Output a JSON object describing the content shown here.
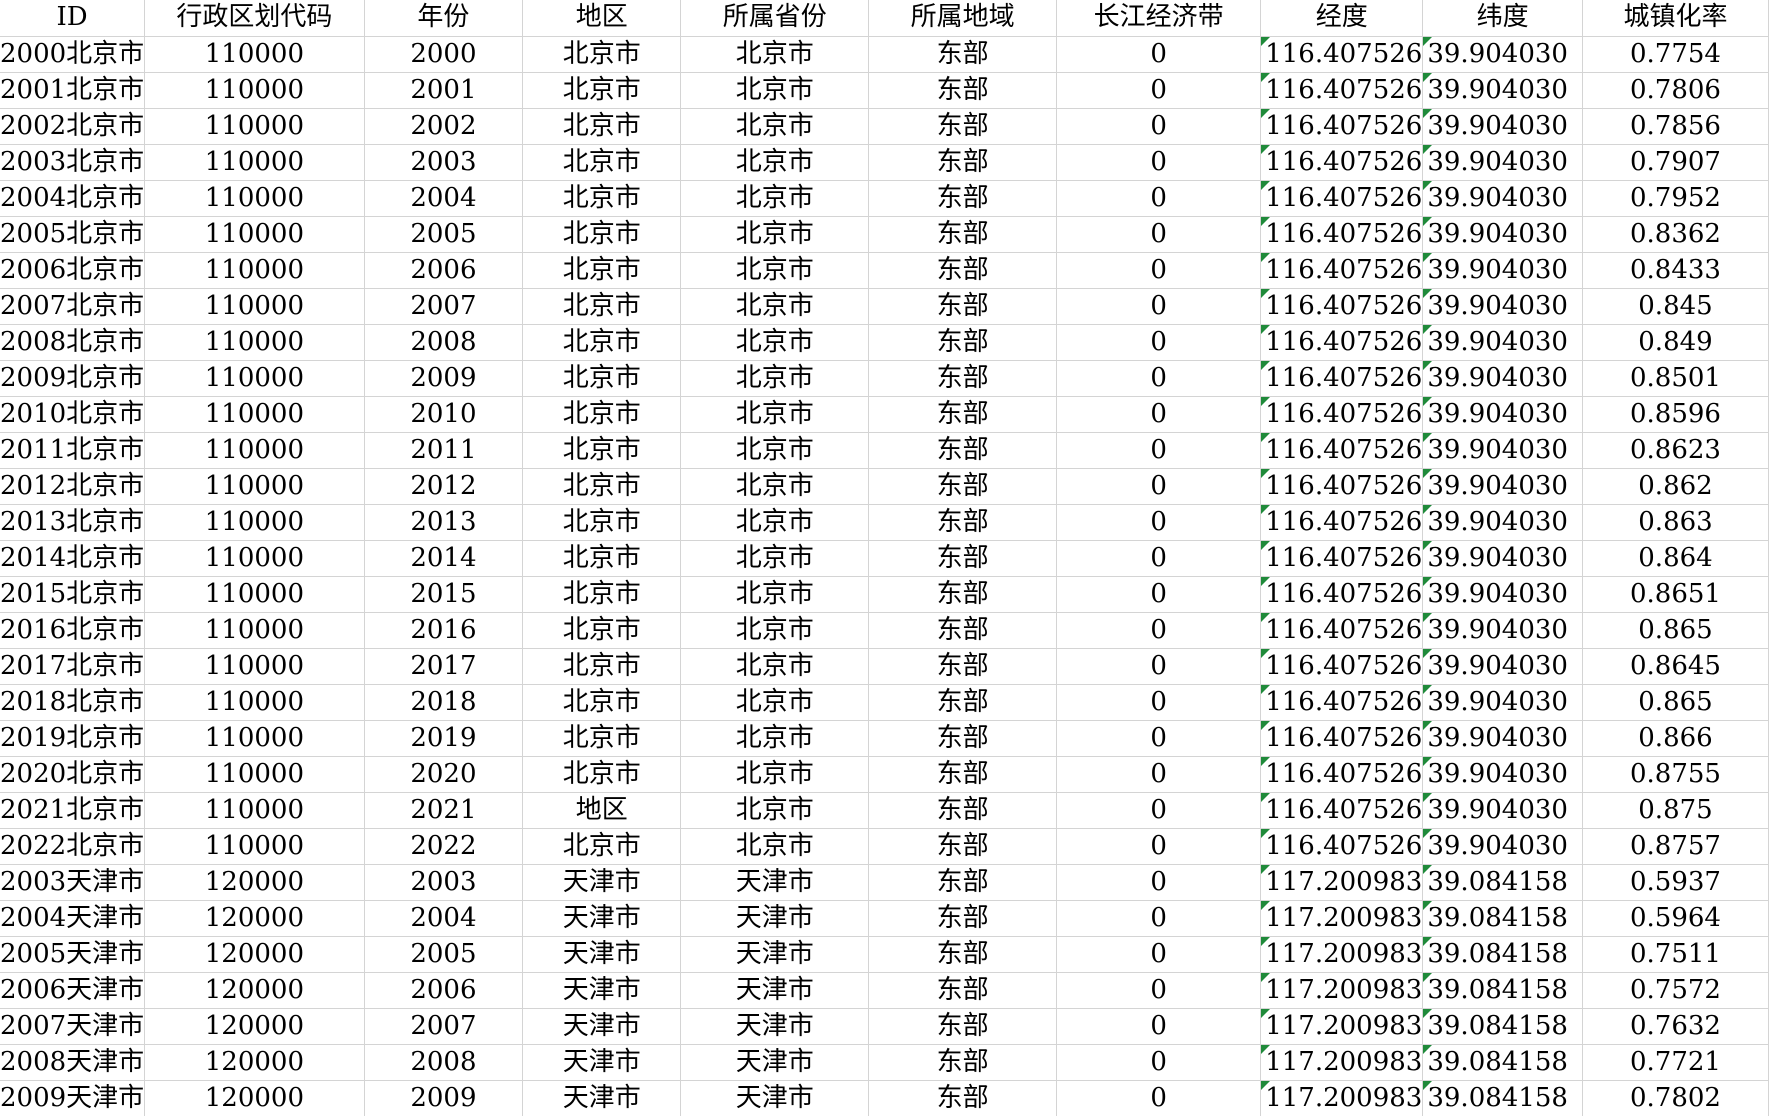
{
  "headers": [
    "ID",
    "行政区划代码",
    "年份",
    "地区",
    "所属省份",
    "所属地域",
    "长江经济带",
    "经度",
    "纬度",
    "城镇化率"
  ],
  "rows": [
    [
      "2000北京市",
      "110000",
      "2000",
      "北京市",
      "北京市",
      "东部",
      "0",
      "116.407526",
      "39.904030",
      "0.7754"
    ],
    [
      "2001北京市",
      "110000",
      "2001",
      "北京市",
      "北京市",
      "东部",
      "0",
      "116.407526",
      "39.904030",
      "0.7806"
    ],
    [
      "2002北京市",
      "110000",
      "2002",
      "北京市",
      "北京市",
      "东部",
      "0",
      "116.407526",
      "39.904030",
      "0.7856"
    ],
    [
      "2003北京市",
      "110000",
      "2003",
      "北京市",
      "北京市",
      "东部",
      "0",
      "116.407526",
      "39.904030",
      "0.7907"
    ],
    [
      "2004北京市",
      "110000",
      "2004",
      "北京市",
      "北京市",
      "东部",
      "0",
      "116.407526",
      "39.904030",
      "0.7952"
    ],
    [
      "2005北京市",
      "110000",
      "2005",
      "北京市",
      "北京市",
      "东部",
      "0",
      "116.407526",
      "39.904030",
      "0.8362"
    ],
    [
      "2006北京市",
      "110000",
      "2006",
      "北京市",
      "北京市",
      "东部",
      "0",
      "116.407526",
      "39.904030",
      "0.8433"
    ],
    [
      "2007北京市",
      "110000",
      "2007",
      "北京市",
      "北京市",
      "东部",
      "0",
      "116.407526",
      "39.904030",
      "0.845"
    ],
    [
      "2008北京市",
      "110000",
      "2008",
      "北京市",
      "北京市",
      "东部",
      "0",
      "116.407526",
      "39.904030",
      "0.849"
    ],
    [
      "2009北京市",
      "110000",
      "2009",
      "北京市",
      "北京市",
      "东部",
      "0",
      "116.407526",
      "39.904030",
      "0.8501"
    ],
    [
      "2010北京市",
      "110000",
      "2010",
      "北京市",
      "北京市",
      "东部",
      "0",
      "116.407526",
      "39.904030",
      "0.8596"
    ],
    [
      "2011北京市",
      "110000",
      "2011",
      "北京市",
      "北京市",
      "东部",
      "0",
      "116.407526",
      "39.904030",
      "0.8623"
    ],
    [
      "2012北京市",
      "110000",
      "2012",
      "北京市",
      "北京市",
      "东部",
      "0",
      "116.407526",
      "39.904030",
      "0.862"
    ],
    [
      "2013北京市",
      "110000",
      "2013",
      "北京市",
      "北京市",
      "东部",
      "0",
      "116.407526",
      "39.904030",
      "0.863"
    ],
    [
      "2014北京市",
      "110000",
      "2014",
      "北京市",
      "北京市",
      "东部",
      "0",
      "116.407526",
      "39.904030",
      "0.864"
    ],
    [
      "2015北京市",
      "110000",
      "2015",
      "北京市",
      "北京市",
      "东部",
      "0",
      "116.407526",
      "39.904030",
      "0.8651"
    ],
    [
      "2016北京市",
      "110000",
      "2016",
      "北京市",
      "北京市",
      "东部",
      "0",
      "116.407526",
      "39.904030",
      "0.865"
    ],
    [
      "2017北京市",
      "110000",
      "2017",
      "北京市",
      "北京市",
      "东部",
      "0",
      "116.407526",
      "39.904030",
      "0.8645"
    ],
    [
      "2018北京市",
      "110000",
      "2018",
      "北京市",
      "北京市",
      "东部",
      "0",
      "116.407526",
      "39.904030",
      "0.865"
    ],
    [
      "2019北京市",
      "110000",
      "2019",
      "北京市",
      "北京市",
      "东部",
      "0",
      "116.407526",
      "39.904030",
      "0.866"
    ],
    [
      "2020北京市",
      "110000",
      "2020",
      "北京市",
      "北京市",
      "东部",
      "0",
      "116.407526",
      "39.904030",
      "0.8755"
    ],
    [
      "2021北京市",
      "110000",
      "2021",
      "地区",
      "北京市",
      "东部",
      "0",
      "116.407526",
      "39.904030",
      "0.875"
    ],
    [
      "2022北京市",
      "110000",
      "2022",
      "北京市",
      "北京市",
      "东部",
      "0",
      "116.407526",
      "39.904030",
      "0.8757"
    ],
    [
      "2003天津市",
      "120000",
      "2003",
      "天津市",
      "天津市",
      "东部",
      "0",
      "117.200983",
      "39.084158",
      "0.5937"
    ],
    [
      "2004天津市",
      "120000",
      "2004",
      "天津市",
      "天津市",
      "东部",
      "0",
      "117.200983",
      "39.084158",
      "0.5964"
    ],
    [
      "2005天津市",
      "120000",
      "2005",
      "天津市",
      "天津市",
      "东部",
      "0",
      "117.200983",
      "39.084158",
      "0.7511"
    ],
    [
      "2006天津市",
      "120000",
      "2006",
      "天津市",
      "天津市",
      "东部",
      "0",
      "117.200983",
      "39.084158",
      "0.7572"
    ],
    [
      "2007天津市",
      "120000",
      "2007",
      "天津市",
      "天津市",
      "东部",
      "0",
      "117.200983",
      "39.084158",
      "0.7632"
    ],
    [
      "2008天津市",
      "120000",
      "2008",
      "天津市",
      "天津市",
      "东部",
      "0",
      "117.200983",
      "39.084158",
      "0.7721"
    ],
    [
      "2009天津市",
      "120000",
      "2009",
      "天津市",
      "天津市",
      "东部",
      "0",
      "117.200983",
      "39.084158",
      "0.7802"
    ]
  ],
  "colors": {
    "gridline": "#d4d4d4",
    "text_as_number_flag": "#1f8a3a"
  }
}
